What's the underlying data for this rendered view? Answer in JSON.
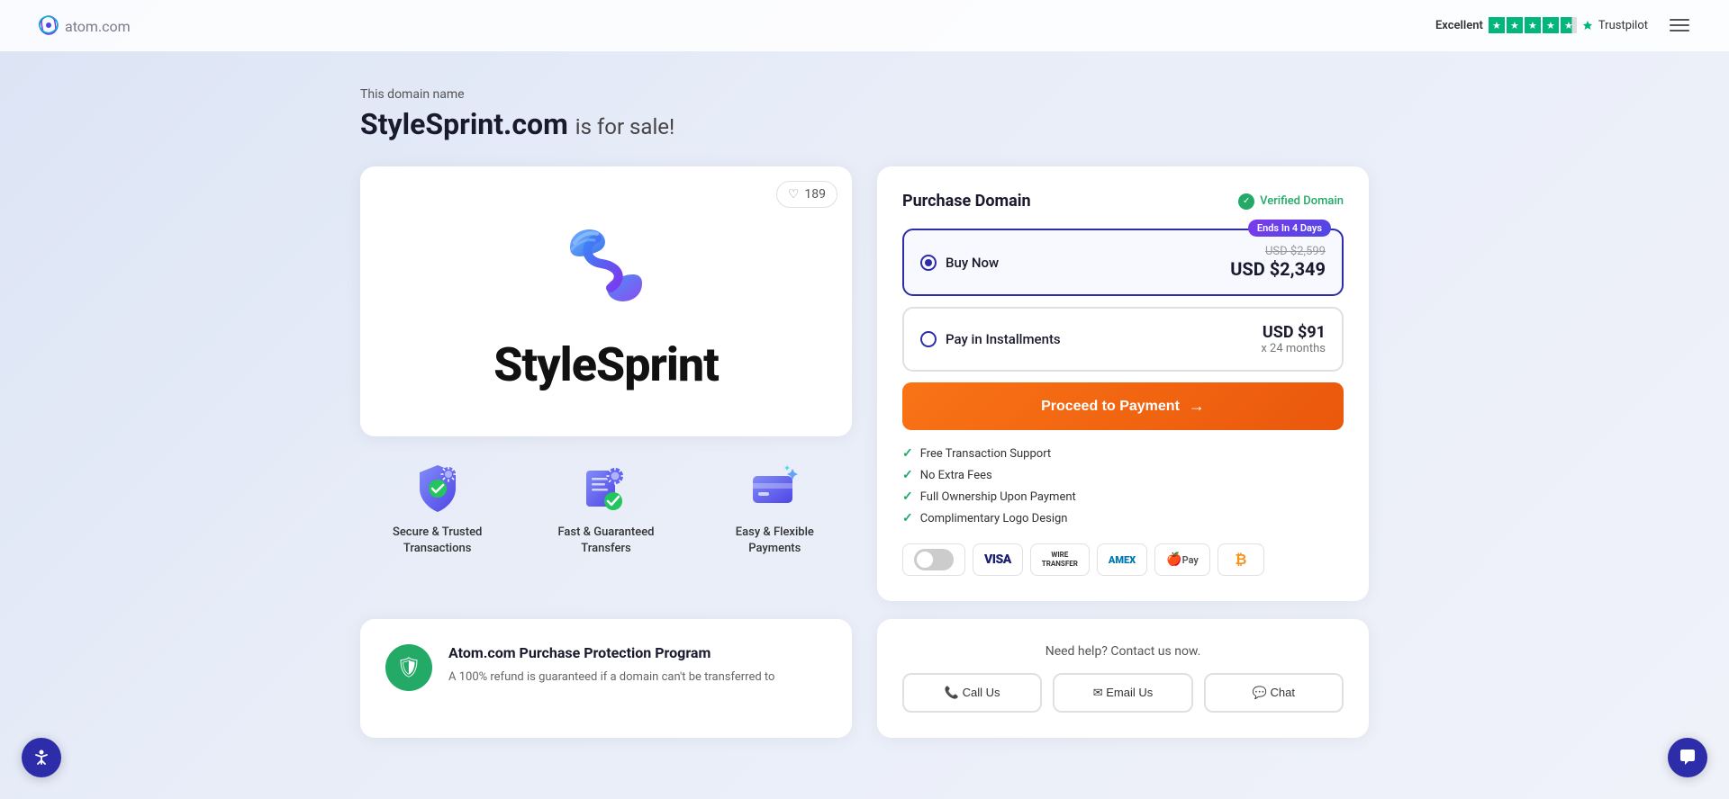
{
  "nav": {
    "logo_text": "atom",
    "logo_domain": ".com",
    "trustpilot_label": "Excellent",
    "trustpilot_name": "Trustpilot",
    "stars_count": 4.5
  },
  "page": {
    "domain_label": "This domain name",
    "domain_name": "StyleSprint.com",
    "for_sale_text": "is for sale!",
    "like_count": "189"
  },
  "brand": {
    "name": "StyleSprint"
  },
  "features": [
    {
      "label": "Secure & Trusted Transactions",
      "icon": "shield"
    },
    {
      "label": "Fast & Guaranteed Transfers",
      "icon": "transfer"
    },
    {
      "label": "Easy & Flexible Payments",
      "icon": "payment"
    }
  ],
  "purchase": {
    "title": "Purchase Domain",
    "verified_label": "Verified Domain",
    "ends_badge": "Ends In 4 Days",
    "buy_now_label": "Buy Now",
    "original_price": "USD $2,599",
    "current_price": "USD $2,349",
    "installments_label": "Pay in Installments",
    "monthly_price": "USD $91",
    "months": "x 24 months",
    "proceed_label": "Proceed to Payment",
    "features": [
      "Free Transaction Support",
      "No Extra Fees",
      "Full Ownership Upon Payment",
      "Complimentary Logo Design"
    ]
  },
  "payment_methods": [
    "VISA",
    "Wire Transfer",
    "AMEX",
    "Apple Pay",
    "Crypto"
  ],
  "protection": {
    "title": "Atom.com Purchase Protection Program",
    "description": "A 100% refund is guaranteed if a domain can't be transferred to"
  },
  "contact": {
    "label": "Need help? Contact us now."
  }
}
